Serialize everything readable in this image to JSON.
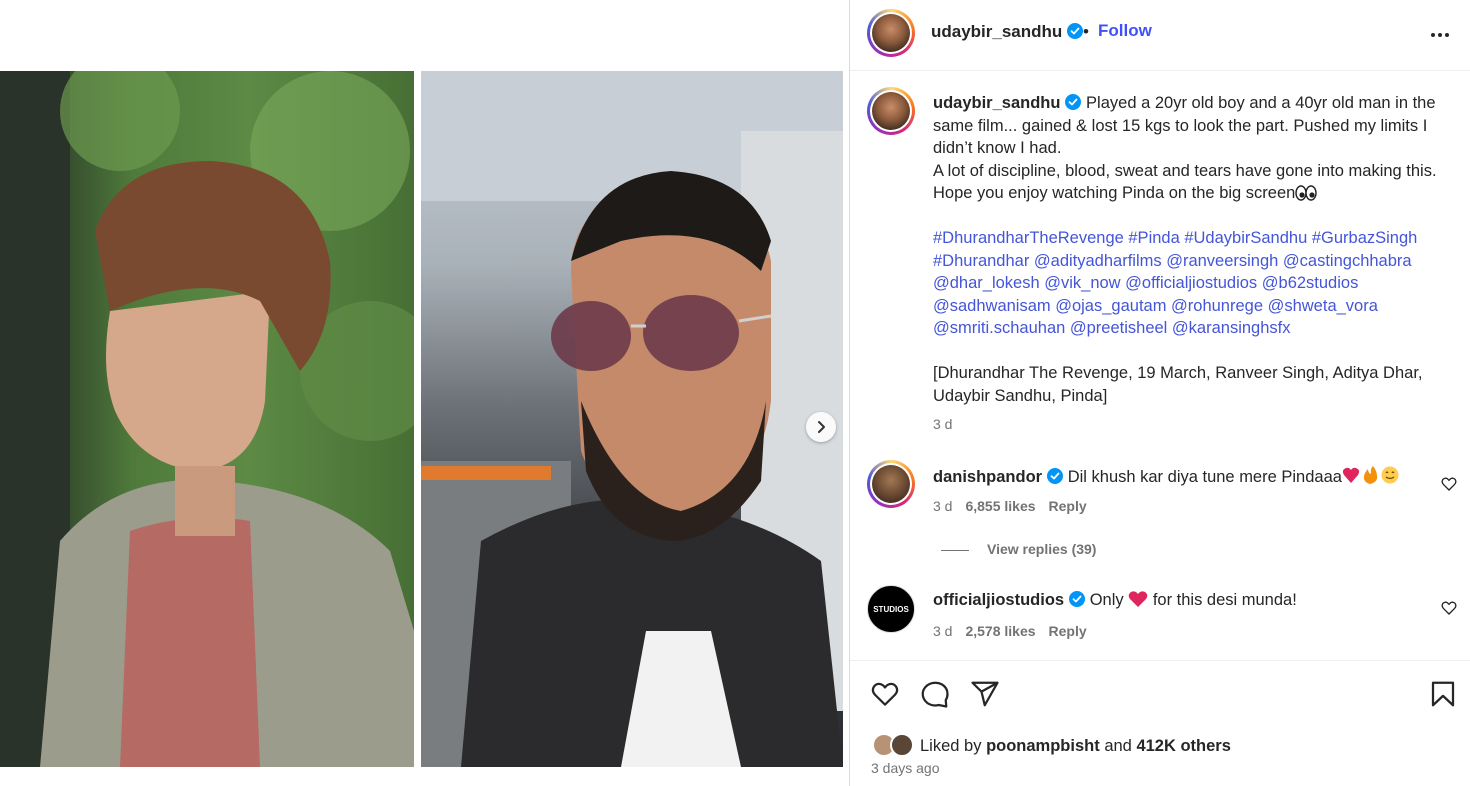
{
  "post": {
    "username": "udaybir_sandhu",
    "follow_label": "Follow",
    "separator": "•",
    "caption_lines": [
      "Played a 20yr old boy and a 40yr old man in the same film... gained & lost 15 kgs to look the part. Pushed my limits I didn’t know I had.",
      "A lot of discipline, blood, sweat and tears have gone into making this. Hope you enjoy watching Pinda on the big screen"
    ],
    "hashtags": "#DhurandharTheRevenge #Pinda #UdaybirSandhu #GurbazSingh #Dhurandhar @adityadharfilms @ranveersingh @castingchhabra @dhar_lokesh @vik_now @officialjiostudios @b62studios @sadhwanisam @ojas_gautam @rohunrege @shweta_vora @smriti.schauhan @preetisheel @karansinghsfx",
    "bracket_note": "[Dhurandhar The Revenge, 19 March, Ranveer Singh, Aditya Dhar, Udaybir Sandhu, Pinda]",
    "caption_time": "3 d"
  },
  "comments": [
    {
      "username": "danishpandor",
      "text": "Dil khush kar diya tune mere Pindaaa",
      "time": "3 d",
      "likes": "6,855 likes",
      "reply_label": "Reply",
      "view_replies": "View replies (39)"
    },
    {
      "username": "officialjiostudios",
      "text_before": "Only",
      "text_after": "for this desi munda!",
      "time": "3 d",
      "likes": "2,578 likes",
      "reply_label": "Reply",
      "avatar_text": "STUDIOS"
    }
  ],
  "footer": {
    "liked_by_prefix": "Liked by",
    "liked_by_user": "poonampbisht",
    "and_label": "and",
    "others": "412K others",
    "post_time": "3 days ago"
  },
  "colors": {
    "link": "#4455d8",
    "follow": "#4150f7",
    "verified": "#0095f6",
    "secondary_text": "#737373"
  },
  "icons": [
    "verified-badge-icon",
    "more-options-icon",
    "heart-icon",
    "comment-icon",
    "share-icon",
    "bookmark-icon",
    "chevron-right-icon"
  ]
}
